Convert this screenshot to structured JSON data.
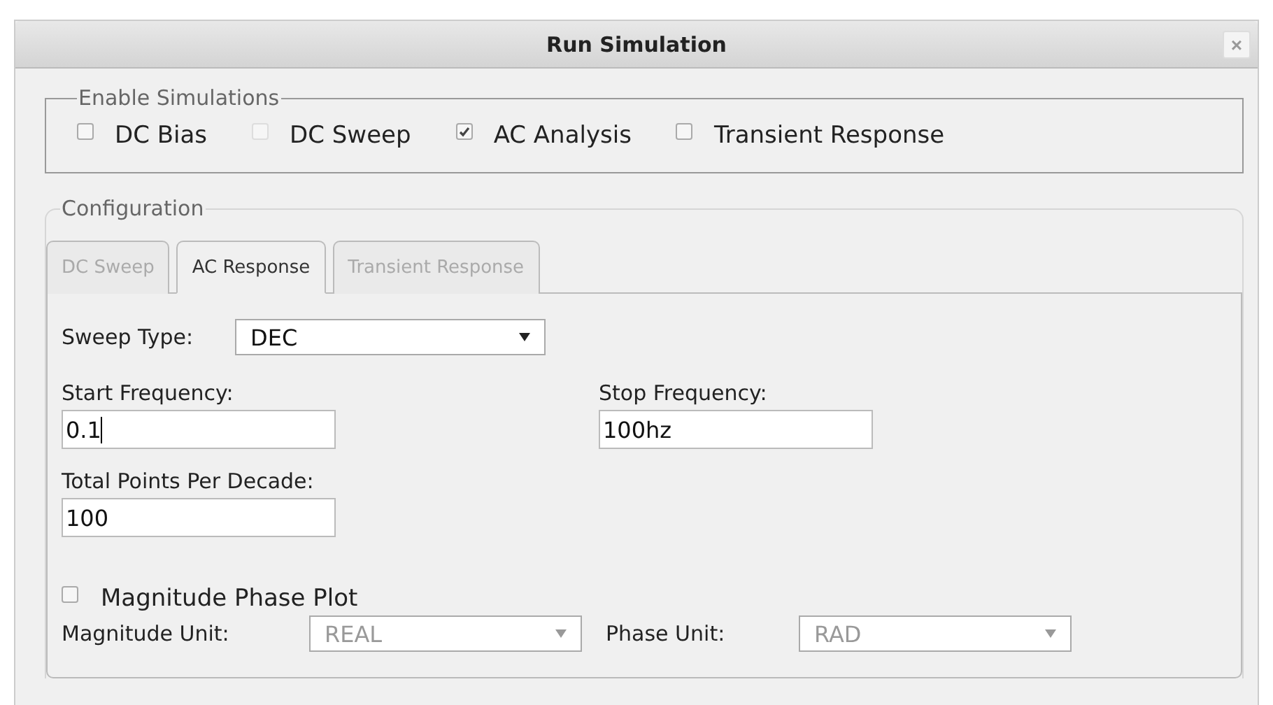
{
  "window": {
    "title": "Run Simulation",
    "close": "×"
  },
  "enable_simulations": {
    "legend": "Enable Simulations",
    "options": [
      {
        "label": "DC Bias",
        "checked": false,
        "disabled": false
      },
      {
        "label": "DC Sweep",
        "checked": false,
        "disabled": true
      },
      {
        "label": "AC Analysis",
        "checked": true,
        "disabled": false
      },
      {
        "label": "Transient Response",
        "checked": false,
        "disabled": false
      }
    ]
  },
  "configuration": {
    "legend": "Configuration",
    "tabs": [
      {
        "label": "DC Sweep",
        "selected": false,
        "disabled": true
      },
      {
        "label": "AC Response",
        "selected": true,
        "disabled": false
      },
      {
        "label": "Transient Response",
        "selected": false,
        "disabled": true
      }
    ],
    "sweep_type": {
      "label": "Sweep Type:",
      "value": "DEC"
    },
    "start_frequency": {
      "label": "Start Frequency:",
      "value": "0.1",
      "focused": true
    },
    "stop_frequency": {
      "label": "Stop Frequency:",
      "value": "100hz"
    },
    "total_points": {
      "label": "Total Points Per Decade:",
      "value": "100"
    },
    "magnitude_phase_plot": {
      "label": "Magnitude Phase Plot",
      "checked": false
    },
    "magnitude_unit": {
      "label": "Magnitude Unit:",
      "value": "REAL",
      "disabled": true
    },
    "phase_unit": {
      "label": "Phase Unit:",
      "value": "RAD",
      "disabled": true
    }
  }
}
